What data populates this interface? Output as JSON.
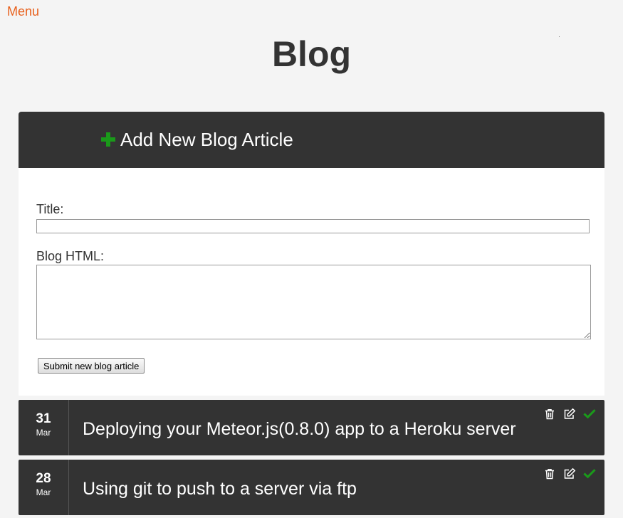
{
  "nav": {
    "menu_label": "Menu"
  },
  "page": {
    "title": "Blog"
  },
  "add_article": {
    "header_label": "Add New Blog Article",
    "title_label": "Title:",
    "title_value": "",
    "html_label": "Blog HTML:",
    "html_value": "",
    "submit_label": "Submit new blog article"
  },
  "articles": [
    {
      "day": "31",
      "month": "Mar",
      "title": "Deploying your Meteor.js(0.8.0) app to a Heroku server",
      "actions": [
        "trash-icon",
        "edit-icon",
        "check-icon"
      ]
    },
    {
      "day": "28",
      "month": "Mar",
      "title": "Using git to push to a server via ftp",
      "actions": [
        "trash-icon",
        "edit-icon",
        "check-icon"
      ]
    }
  ],
  "colors": {
    "accent": "#e8601c",
    "panel": "#333333",
    "add_icon": "#1a9a1a",
    "check": "#1a9a1a",
    "background": "#f4f4f4"
  }
}
